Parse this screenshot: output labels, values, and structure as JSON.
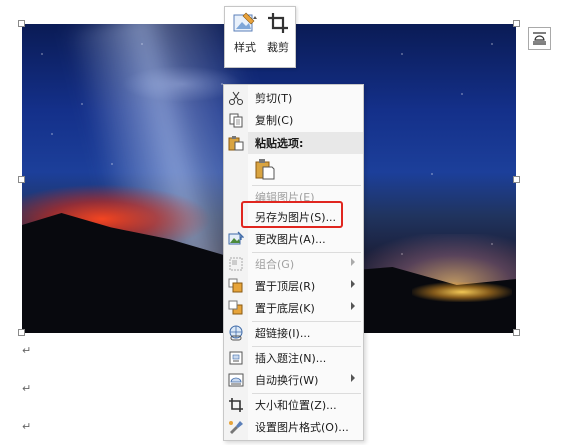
{
  "mini_toolbar": {
    "style_label": "样式",
    "crop_label": "裁剪"
  },
  "context_menu": {
    "cut": "剪切(T)",
    "copy": "复制(C)",
    "paste_options": "粘贴选项:",
    "edit_picture": "编辑图片(E)",
    "save_as_picture": "另存为图片(S)...",
    "change_picture": "更改图片(A)...",
    "group": "组合(G)",
    "bring_to_front": "置于顶层(R)",
    "send_to_back": "置于底层(K)",
    "hyperlink": "超链接(I)...",
    "insert_caption": "插入题注(N)...",
    "wrap_text": "自动换行(W)",
    "size_position": "大小和位置(Z)...",
    "format_picture": "设置图片格式(O)..."
  },
  "document": {
    "paragraph_mark": "↵"
  },
  "colors": {
    "highlight_border": "#e0261f",
    "menu_background": "#fafafa"
  }
}
